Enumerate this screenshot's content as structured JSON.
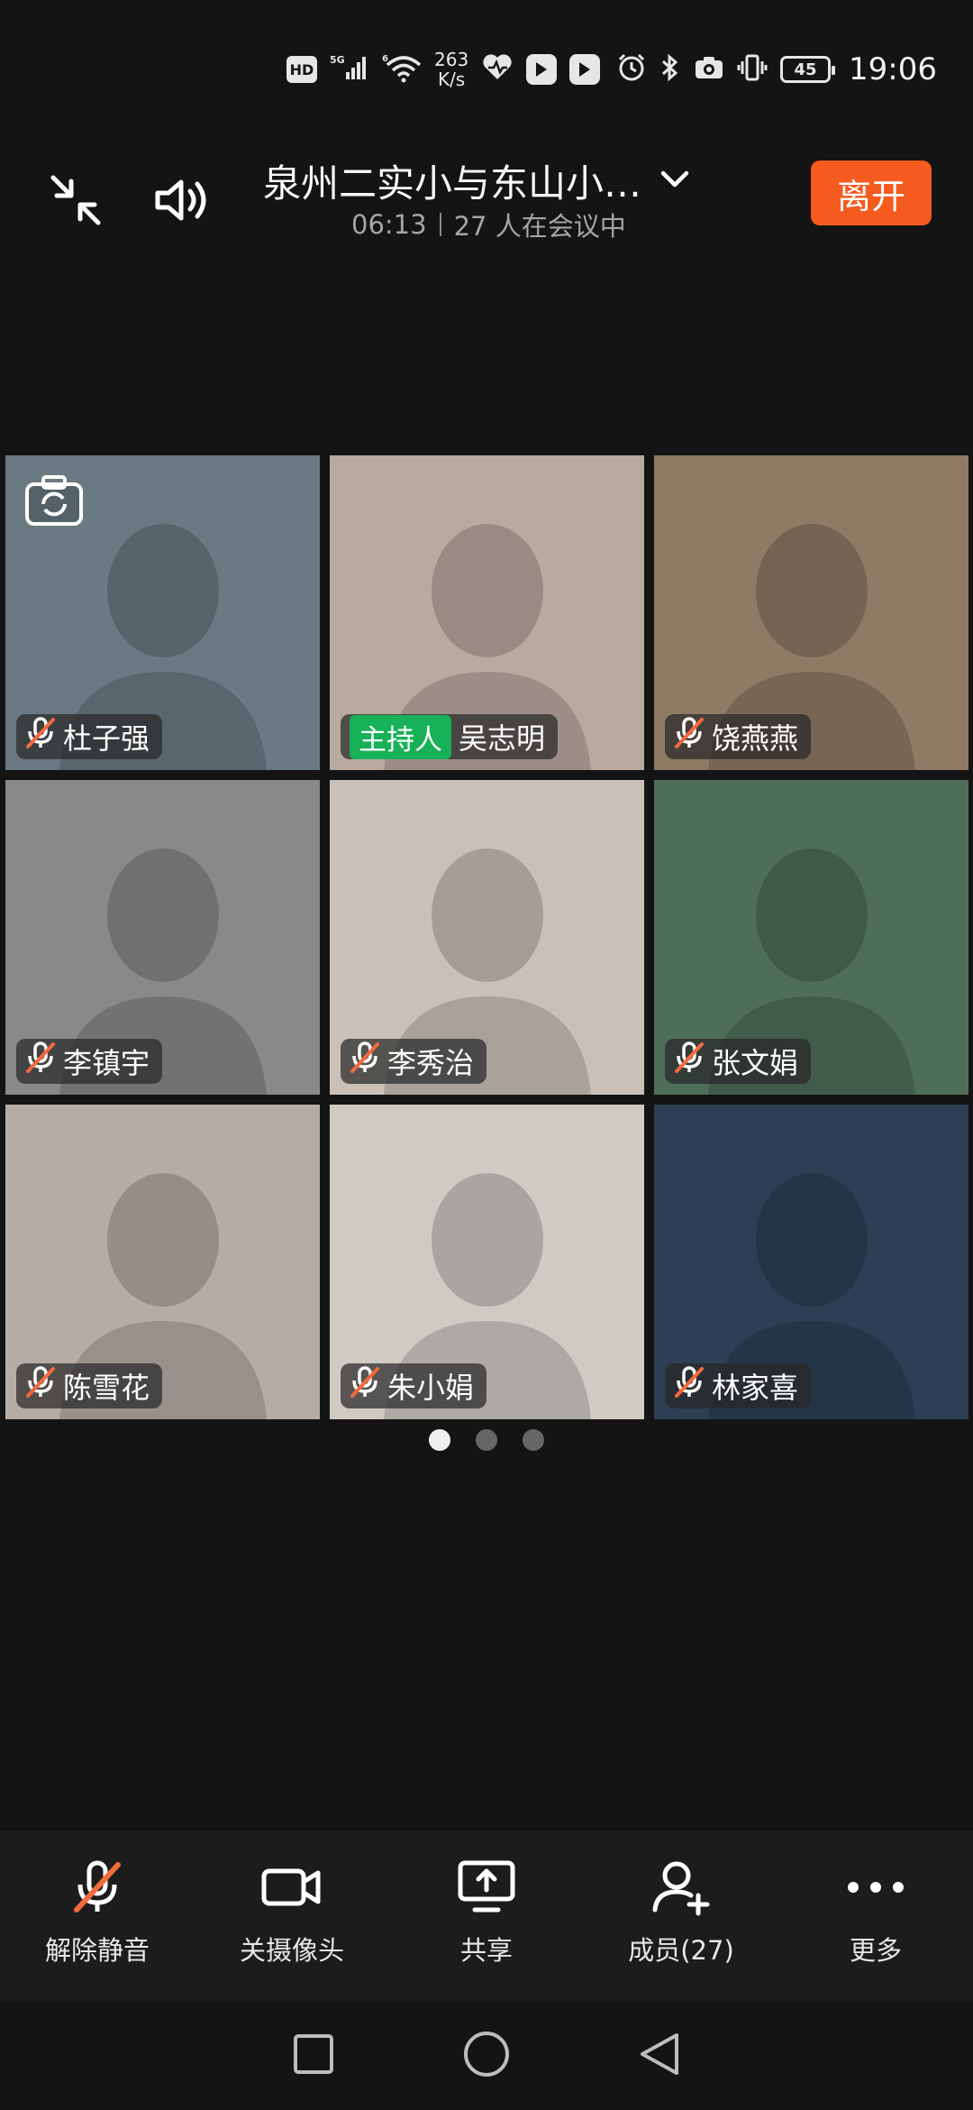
{
  "status_bar": {
    "hd": "HD",
    "net_speed_value": "263",
    "net_speed_unit": "K/s",
    "battery": "45",
    "time": "19:06",
    "icons": [
      "hd-icon",
      "signal-5g-icon",
      "wifi-icon",
      "network-speed",
      "heart-app-icon",
      "app-icon",
      "app-icon",
      "alarm-icon",
      "bluetooth-icon",
      "camera-icon",
      "vibrate-icon",
      "battery-icon"
    ]
  },
  "header": {
    "title": "泉州二实小与东山小…",
    "duration": "06:13",
    "participants_text": "27 人在会议中",
    "leave_label": "离开"
  },
  "participants": [
    {
      "name": "杜子强",
      "muted": true,
      "host": false,
      "bg": "#6b7a82"
    },
    {
      "name": "吴志明",
      "muted": false,
      "host": true,
      "bg": "#b9aaa0"
    },
    {
      "name": "饶燕燕",
      "muted": true,
      "host": false,
      "bg": "#8f7a66"
    },
    {
      "name": "李镇宇",
      "muted": true,
      "host": false,
      "bg": "#8a8888"
    },
    {
      "name": "李秀治",
      "muted": true,
      "host": false,
      "bg": "#c9c1b8"
    },
    {
      "name": "张文娟",
      "muted": true,
      "host": false,
      "bg": "#4f6e5a"
    },
    {
      "name": "陈雪花",
      "muted": true,
      "host": false,
      "bg": "#b6aca6"
    },
    {
      "name": "朱小娟",
      "muted": true,
      "host": false,
      "bg": "#cfcac4"
    },
    {
      "name": "林家喜",
      "muted": true,
      "host": false,
      "bg": "#2d3f55"
    }
  ],
  "host_badge": "主持人",
  "pagination": {
    "pages": 3,
    "current": 1
  },
  "toolbar": {
    "unmute": "解除静音",
    "camera_off": "关摄像头",
    "share": "共享",
    "members": "成员(27)",
    "more": "更多"
  },
  "colors": {
    "leave": "#f55a1e",
    "host_badge": "#17b157",
    "mute_slash": "#f26a3d"
  }
}
